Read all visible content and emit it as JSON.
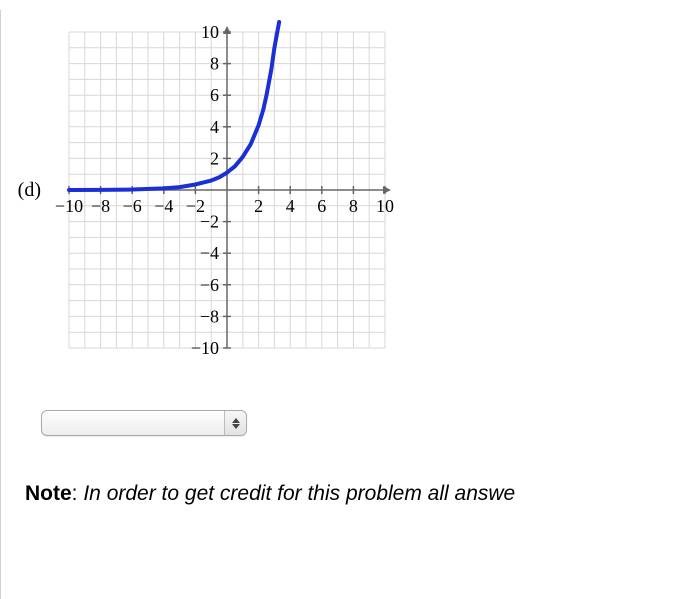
{
  "part_label": "(d)",
  "note_bold": "Note",
  "note_sep": ": ",
  "note_italic": "In order to get credit for this problem all answe",
  "combo_value": "",
  "chart_data": {
    "type": "line",
    "xlabel": "",
    "ylabel": "",
    "xlim": [
      -10,
      10
    ],
    "ylim": [
      -10,
      10
    ],
    "x_ticks": [
      -10,
      -8,
      -6,
      -4,
      -2,
      2,
      4,
      6,
      8,
      10
    ],
    "y_ticks": [
      -10,
      -8,
      -6,
      -4,
      -2,
      2,
      4,
      6,
      8,
      10
    ],
    "grid": true,
    "series": [
      {
        "name": "curve",
        "x": [
          -10,
          -8,
          -6,
          -4,
          -3,
          -2,
          -1,
          -0.5,
          0,
          0.5,
          1,
          1.5,
          2,
          2.3,
          2.5,
          2.8,
          3.0,
          3.3
        ],
        "y": [
          0.0,
          0.01,
          0.03,
          0.1,
          0.18,
          0.35,
          0.6,
          0.8,
          1.1,
          1.5,
          2.1,
          2.9,
          4.1,
          5.1,
          6.0,
          7.6,
          9.0,
          11.5
        ]
      }
    ]
  }
}
